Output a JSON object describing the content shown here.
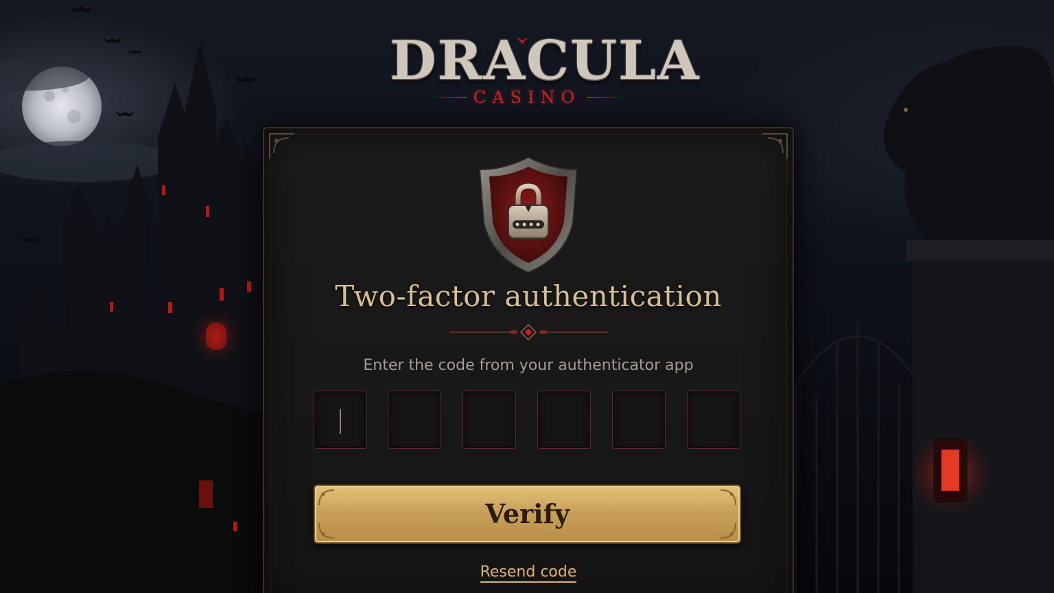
{
  "brand": {
    "name": "DRACULA",
    "subtitle": "CASINO"
  },
  "auth": {
    "title": "Two-factor authentication",
    "instruction": "Enter the code from your authenticator app",
    "code_length": 6,
    "code_values": [
      "",
      "",
      "",
      "",
      "",
      ""
    ],
    "active_digit_index": 0,
    "verify_label": "Verify",
    "resend_label": "Resend code"
  },
  "icons": {
    "header_icon": "shield-lock-icon",
    "divider": "ornamental-divider-icon"
  },
  "colors": {
    "accent_gold": "#d6bf96",
    "button_gold": "#c9a15a",
    "blood_red": "#c4262a",
    "panel_bg": "#1a1919"
  }
}
